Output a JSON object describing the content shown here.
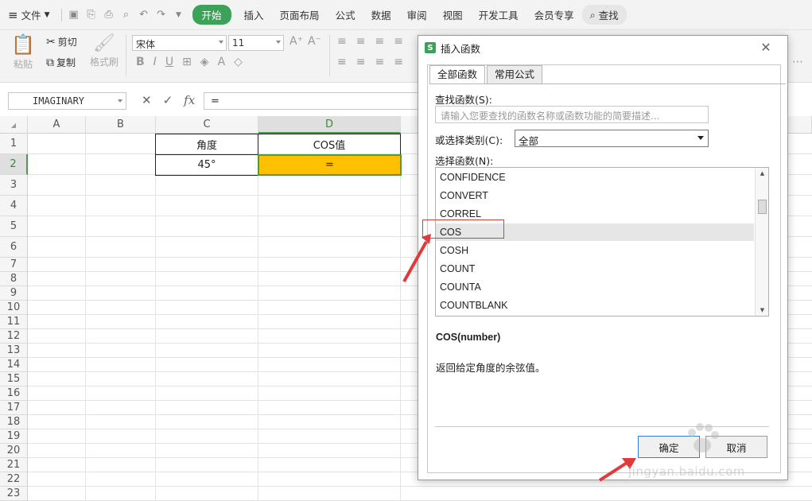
{
  "menu": {
    "file": "文件",
    "tabs": [
      "开始",
      "插入",
      "页面布局",
      "公式",
      "数据",
      "审阅",
      "视图",
      "开发工具",
      "会员专享"
    ],
    "active_tab": "开始",
    "search": "查找"
  },
  "ribbon": {
    "paste": "粘贴",
    "cut": "剪切",
    "copy": "复制",
    "format_painter": "格式刷",
    "font_name": "宋体",
    "font_size": "11"
  },
  "formula_bar": {
    "name_box": "IMAGINARY",
    "formula": "="
  },
  "sheet": {
    "columns": [
      "A",
      "B",
      "C",
      "D"
    ],
    "rows": [
      "1",
      "2",
      "3",
      "4",
      "5",
      "6",
      "7",
      "8",
      "9",
      "10",
      "11",
      "12",
      "13",
      "14",
      "15",
      "16",
      "17",
      "18",
      "19",
      "20",
      "21",
      "22",
      "23"
    ],
    "selected_column": "D",
    "selected_row": "2",
    "cells": {
      "C1": "角度",
      "D1": "COS值",
      "C2": "45°",
      "D2": "="
    },
    "active_cell_color": "#ffc000",
    "selection_color": "#4a9c4a"
  },
  "dialog": {
    "title": "插入函数",
    "logo": "S",
    "tabs": [
      "全部函数",
      "常用公式"
    ],
    "search_label": "查找函数(S):",
    "search_placeholder": "请输入您要查找的函数名称或函数功能的简要描述...",
    "category_label": "或选择类别(C):",
    "category_value": "全部",
    "function_label": "选择函数(N):",
    "functions": [
      "CONFIDENCE",
      "CONVERT",
      "CORREL",
      "COS",
      "COSH",
      "COUNT",
      "COUNTA",
      "COUNTBLANK"
    ],
    "selected_function": "COS",
    "signature": "COS(number)",
    "description": "返回给定角度的余弦值。",
    "ok_button": "确定",
    "cancel_button": "取消"
  },
  "watermark": "jingyan.baidu.com",
  "annotation_color": "#e03a3a"
}
